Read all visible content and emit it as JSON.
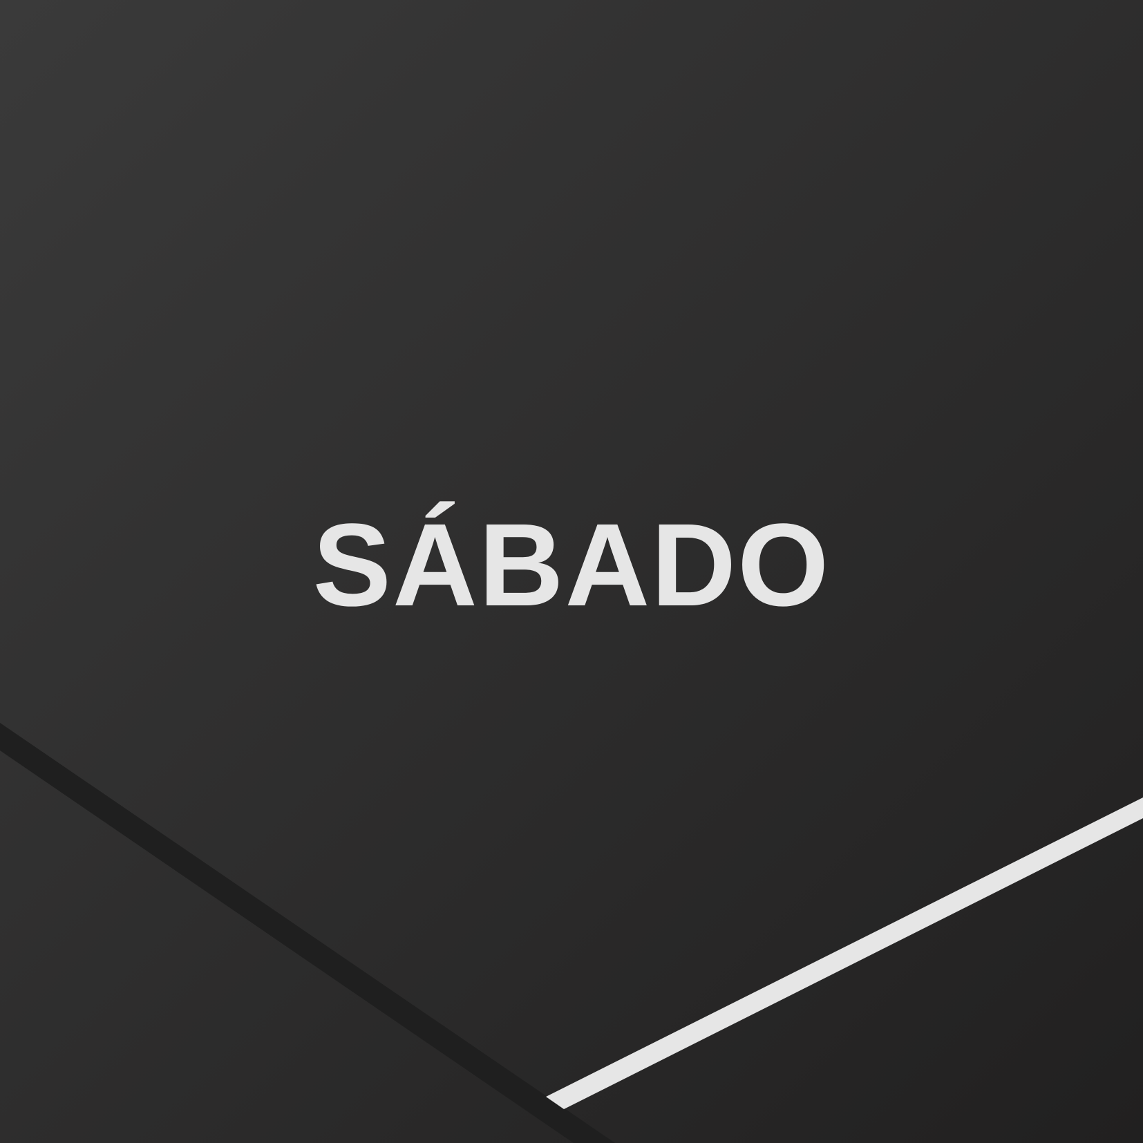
{
  "title": {
    "text": "SÁBADO"
  },
  "colors": {
    "background_start": "#3a3a3a",
    "background_end": "#212020",
    "text": "#e6e6e6",
    "light_stripe": "#e6e6e6",
    "dark_stripe": "#1f1f1f"
  }
}
